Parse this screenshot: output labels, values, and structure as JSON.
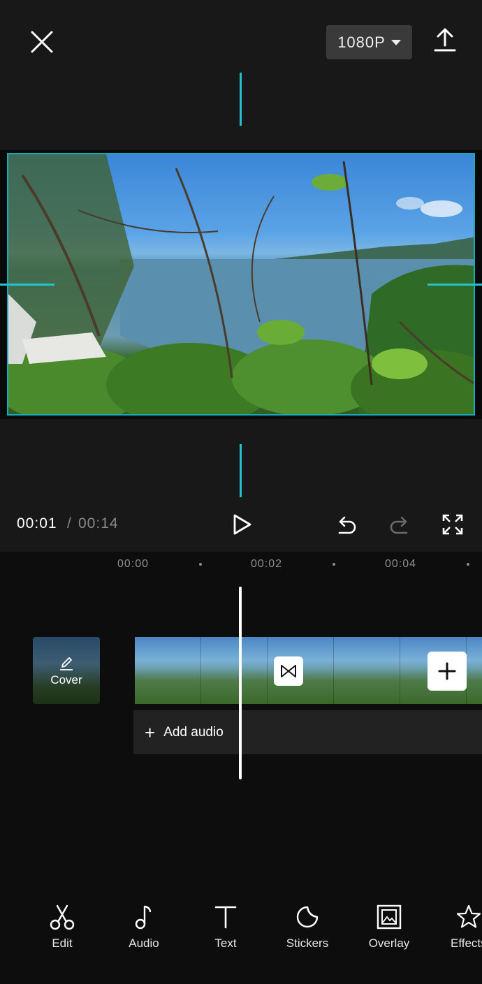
{
  "header": {
    "resolution_label": "1080P"
  },
  "playback": {
    "current_time": "00:01",
    "separator": "/",
    "total_time": "00:14"
  },
  "timeline": {
    "ruler": [
      "00:00",
      "00:02",
      "00:04"
    ],
    "cover_label": "Cover",
    "add_audio_label": "Add audio"
  },
  "toolbar": {
    "items": [
      {
        "label": "Edit",
        "icon": "scissors-icon"
      },
      {
        "label": "Audio",
        "icon": "music-note-icon"
      },
      {
        "label": "Text",
        "icon": "text-icon"
      },
      {
        "label": "Stickers",
        "icon": "sticker-icon"
      },
      {
        "label": "Overlay",
        "icon": "overlay-icon"
      },
      {
        "label": "Effects",
        "icon": "effects-star-icon"
      }
    ]
  },
  "colors": {
    "guide": "#1fc6d2",
    "background": "#181818"
  }
}
